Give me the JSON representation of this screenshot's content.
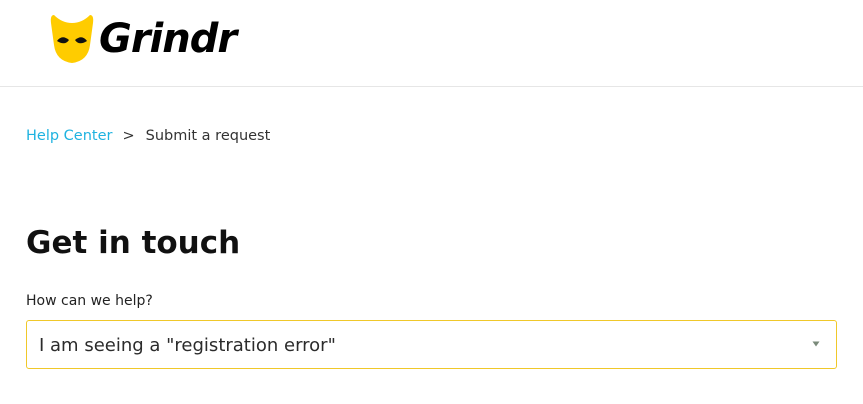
{
  "brand": {
    "name": "Grindr",
    "logo_color": "#FFCC00"
  },
  "breadcrumb": {
    "home": "Help Center",
    "separator": ">",
    "current": "Submit a request"
  },
  "page": {
    "title": "Get in touch"
  },
  "form": {
    "help_label": "How can we help?",
    "help_selected": "I am seeing a \"registration error\""
  },
  "colors": {
    "link": "#1FB3E0",
    "field_border": "#F0C82A"
  },
  "icons": {
    "mask": "grindr-mask-icon",
    "caret": "caret-down-icon"
  }
}
